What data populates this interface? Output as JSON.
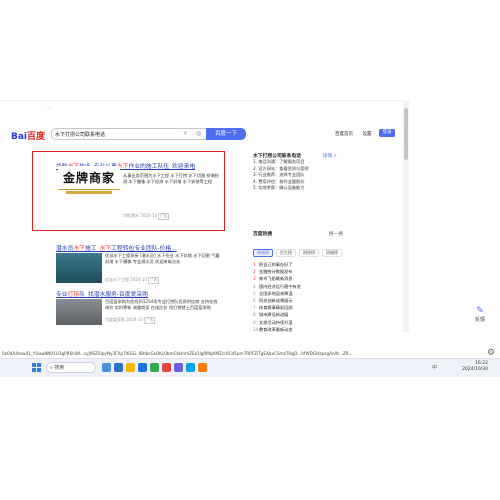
{
  "browser": {
    "top_snippet": "...",
    "address_bar": "0x04A4mw41_YUuw9N01U3gPR6hiW...cyJ9SZ5lpyNy3FXp7l6GG..IBhbcGsOKc0bmCbHmhZEz1IgRMqXMZcr0Cd5pm7RPFZiTgEAbxCSmzTHgD...hfWDGHzpsgAnAt...ZR..."
  },
  "baidu": {
    "logo_text": "Bai",
    "logo_du": "百度",
    "query": "水下打捞公司联系电话",
    "clear_icon": "×",
    "search_button": "百度一下",
    "header_links": [
      "百度首页",
      "设置"
    ],
    "login_button": "登录"
  },
  "results": [
    {
      "title_parts": [
        "华航",
        "水下",
        "作业_专业从事",
        "水下",
        "作业的施工队伍_欢迎来电"
      ],
      "snippet": "从事业务范围为水下工程 水下打捞 水下切割 桥墩检测 水下摄像 水下检测 水下封堵 水下安装等工程",
      "meta": "华航潜水 2024-10",
      "logo_title": "金牌商家",
      "ad_tag": "广告"
    },
    {
      "title_parts": [
        "潜水员",
        "水下",
        "施工_",
        "水下",
        "工程转包专业团队-价格..."
      ],
      "snippet": "优派水下工程承接 [潜水员] 水下作业 水下封堵 水下切割 气囊封堵 水下摄像 专业潜水员 欢迎来电洽谈",
      "meta": "优派水下工程 2024-10",
      "ad_tag": "广告"
    },
    {
      "title_parts": [
        "专业",
        "打捞",
        "队_",
        "找潜水服务",
        "-百度爱采购"
      ],
      "snippet": "百度爱采购为您找到1254条专业打捞队优质供应商 支持在线询价 实时更新 海量商家 在线比价 找打捞就上百度爱采购",
      "meta": "百度爱采购 2024-10",
      "ad_tag": "广告"
    }
  ],
  "sidebar": {
    "ai_box": {
      "heading": "水下打捞公司联系电话",
      "more": "详情 »",
      "items": [
        "1. 电话沟通：了解服务项目",
        "2. 官方网站：查看资质与案例",
        "3. 行业推荐：选择专业团队",
        "4. 费用评估：按作业量报价",
        "5. 实地考察：确认设备能力"
      ]
    },
    "hot": {
      "heading": "百度热搜",
      "refresh": "换一换",
      "tabs": [
        "热搜榜",
        "民生榜",
        "财经榜",
        "同城榜"
      ],
      "items": [
        "把自己的事办好了",
        "金融统计数据发布",
        "神舟飞船最新消息",
        "国内经济运行稳中有进",
        "全国多地迎来降温",
        "科技创新成果展示",
        "体育赛事精彩回顾",
        "城市建设新进展",
        "文旅活动持续升温",
        "教育改革最新动态"
      ]
    }
  },
  "side_helper": {
    "label": "反馈"
  },
  "taskbar": {
    "search_placeholder": "搜索",
    "tray_lang": "中",
    "time": "16:22",
    "date": "2024/10/30"
  }
}
